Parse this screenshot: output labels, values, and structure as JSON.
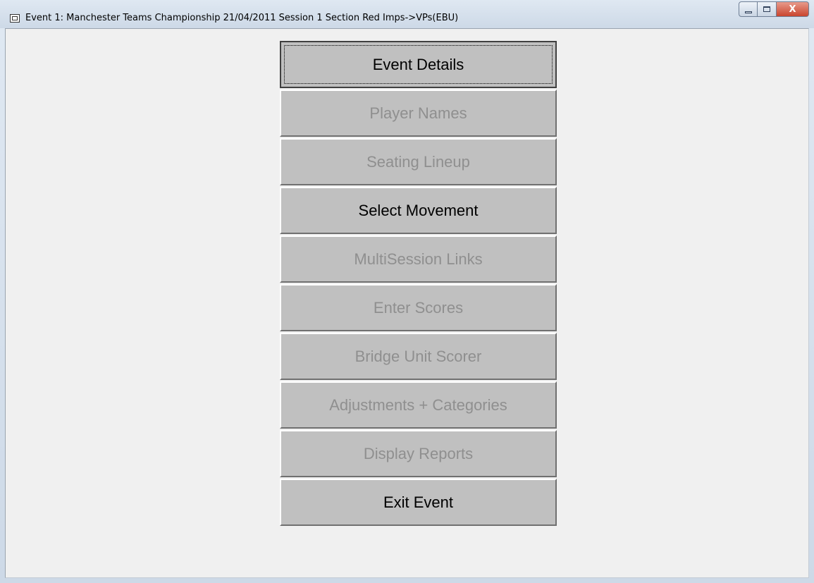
{
  "window": {
    "title": "Event 1: Manchester Teams Championship 21/04/2011 Session 1 Section Red Imps->VPs(EBU)",
    "controls": {
      "minimize": "",
      "maximize": "",
      "close": "X"
    }
  },
  "menu": {
    "items": [
      {
        "label": "Event Details",
        "enabled": true,
        "focused": true
      },
      {
        "label": "Player Names",
        "enabled": false
      },
      {
        "label": "Seating Lineup",
        "enabled": false
      },
      {
        "label": "Select Movement",
        "enabled": true
      },
      {
        "label": "MultiSession Links",
        "enabled": false
      },
      {
        "label": "Enter Scores",
        "enabled": false
      },
      {
        "label": "Bridge Unit Scorer",
        "enabled": false
      },
      {
        "label": "Adjustments + Categories",
        "enabled": false
      },
      {
        "label": "Display Reports",
        "enabled": false
      },
      {
        "label": "Exit Event",
        "enabled": true
      }
    ]
  },
  "colors": {
    "button_face": "#c0c0c0",
    "enabled_text": "#000000",
    "disabled_text": "#8f8f8f"
  }
}
